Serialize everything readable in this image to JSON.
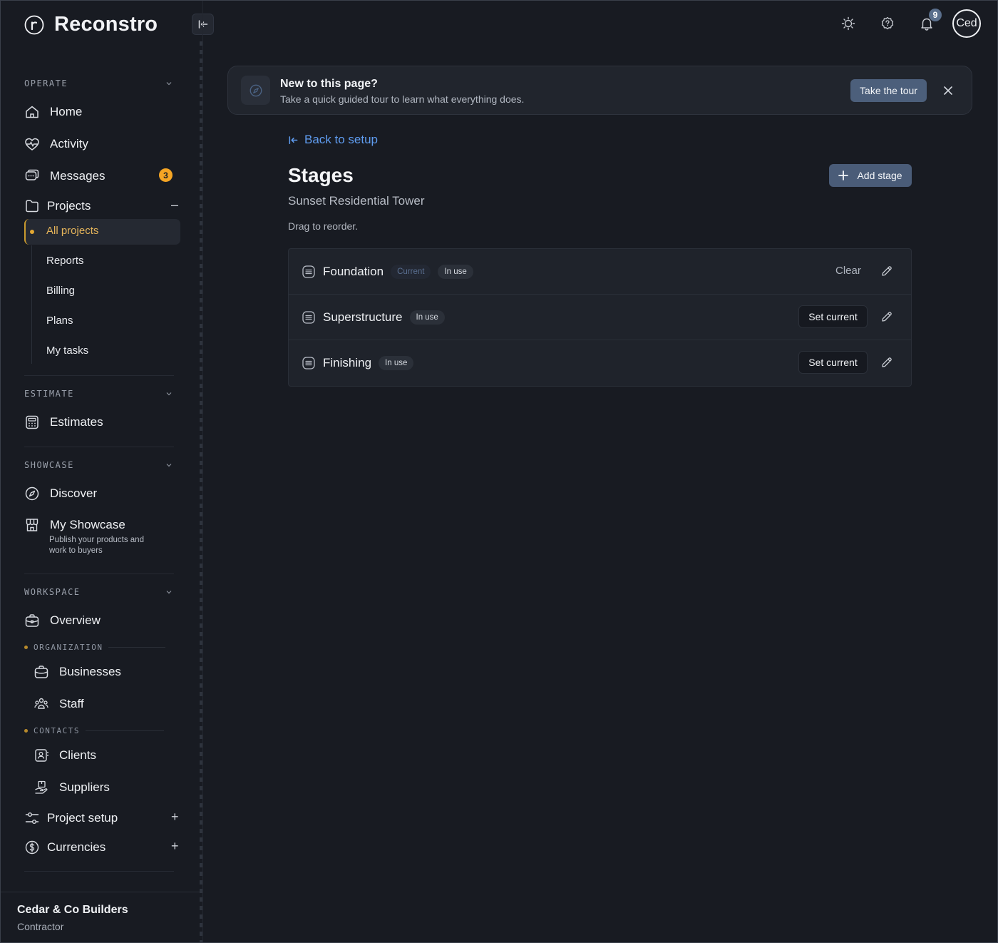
{
  "app": {
    "name": "Reconstro"
  },
  "topbar": {
    "notification_count": "9",
    "avatar_text": "Ced"
  },
  "sidebar": {
    "operate_label": "OPERATE",
    "home": "Home",
    "activity": "Activity",
    "messages": "Messages",
    "messages_badge": "3",
    "projects": "Projects",
    "all_projects": "All projects",
    "reports": "Reports",
    "billing": "Billing",
    "plans": "Plans",
    "my_tasks": "My tasks",
    "estimate_label": "ESTIMATE",
    "estimates": "Estimates",
    "showcase_label": "SHOWCASE",
    "discover": "Discover",
    "my_showcase": "My Showcase",
    "my_showcase_desc": "Publish your products and work to buyers",
    "workspace_label": "WORKSPACE",
    "overview": "Overview",
    "organization_label": "ORGANIZATION",
    "businesses": "Businesses",
    "staff": "Staff",
    "contacts_label": "CONTACTS",
    "clients": "Clients",
    "suppliers": "Suppliers",
    "project_setup": "Project setup",
    "currencies": "Currencies"
  },
  "footer": {
    "company": "Cedar & Co Builders",
    "role": "Contractor"
  },
  "banner": {
    "title": "New to this page?",
    "subtitle": "Take a quick guided tour to learn what everything does.",
    "tour_button": "Take the tour"
  },
  "main": {
    "back_link": "Back to setup",
    "title": "Stages",
    "subtitle": "Sunset Residential Tower",
    "hint": "Drag to reorder.",
    "add_button": "Add stage",
    "stages": [
      {
        "name": "Foundation",
        "current_tag": "Current",
        "status": "In use",
        "action": "Clear"
      },
      {
        "name": "Superstructure",
        "status": "In use",
        "action": "Set current"
      },
      {
        "name": "Finishing",
        "status": "In use",
        "action": "Set current"
      }
    ]
  },
  "colors": {
    "background": "#181b22",
    "accent_link": "#5f9cf0",
    "active_nav": "#e5b45a",
    "badge": "#f5a524",
    "primary_button": "#4a5c78"
  }
}
